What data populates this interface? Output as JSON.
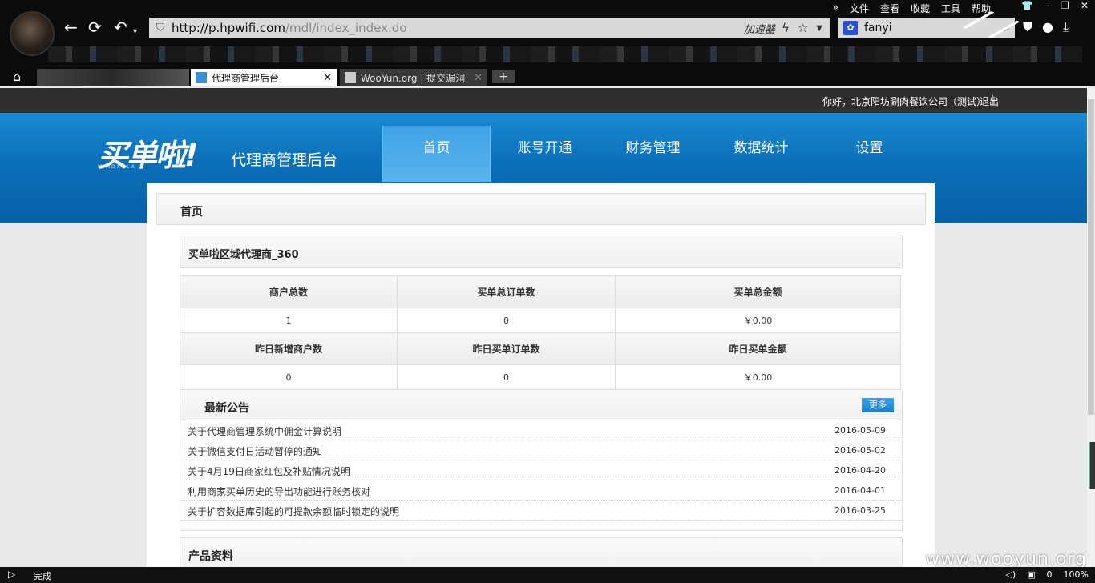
{
  "browser": {
    "menu": [
      "文件",
      "查看",
      "收藏",
      "工具",
      "帮助"
    ],
    "menu_more": "»",
    "address_url_host": "http://p.hpwifi.com",
    "address_url_path": "/mdl/index_index.do",
    "accelerator_label": "加速器",
    "search_value": "fanyi",
    "tabs": [
      {
        "label": "代理商管理后台",
        "close": "✕"
      },
      {
        "label": "WooYun.org | 提交漏洞",
        "close": "✕"
      }
    ],
    "new_tab": "+",
    "status_text": "完成",
    "status_count": "0",
    "zoom": "100%"
  },
  "site": {
    "greeting": "你好，北京阳坊涮肉餐饮公司（测试）",
    "separator": "|",
    "logout": "退出",
    "logo": "买单啦!",
    "logo_sub": "MAIDANLA",
    "name": "代理商管理后台",
    "nav": [
      "首页",
      "账号开通",
      "财务管理",
      "数据统计",
      "设置"
    ]
  },
  "page": {
    "breadcrumb": "首页",
    "agent": "买单啦区域代理商_360",
    "stats_headers_1": [
      "商户总数",
      "买单总订单数",
      "买单总金额"
    ],
    "stats_values_1": [
      "1",
      "0",
      "￥0.00"
    ],
    "stats_headers_2": [
      "昨日新增商户数",
      "昨日买单订单数",
      "昨日买单金额"
    ],
    "stats_values_2": [
      "0",
      "0",
      "￥0.00"
    ],
    "notice_title": "最新公告",
    "more_label": "更多",
    "notices": [
      {
        "title": "关于代理商管理系统中佣金计算说明",
        "date": "2016-05-09"
      },
      {
        "title": "关于微信支付日活动暂停的通知",
        "date": "2016-05-02"
      },
      {
        "title": "关于4月19日商家红包及补贴情况说明",
        "date": "2016-04-20"
      },
      {
        "title": "利用商家买单历史的导出功能进行账务核对",
        "date": "2016-04-01"
      },
      {
        "title": "关于扩容数据库引起的可提款余额临时锁定的说明",
        "date": "2016-03-25"
      }
    ],
    "products_title": "产品资料"
  },
  "watermark": "www.wooyun.org"
}
